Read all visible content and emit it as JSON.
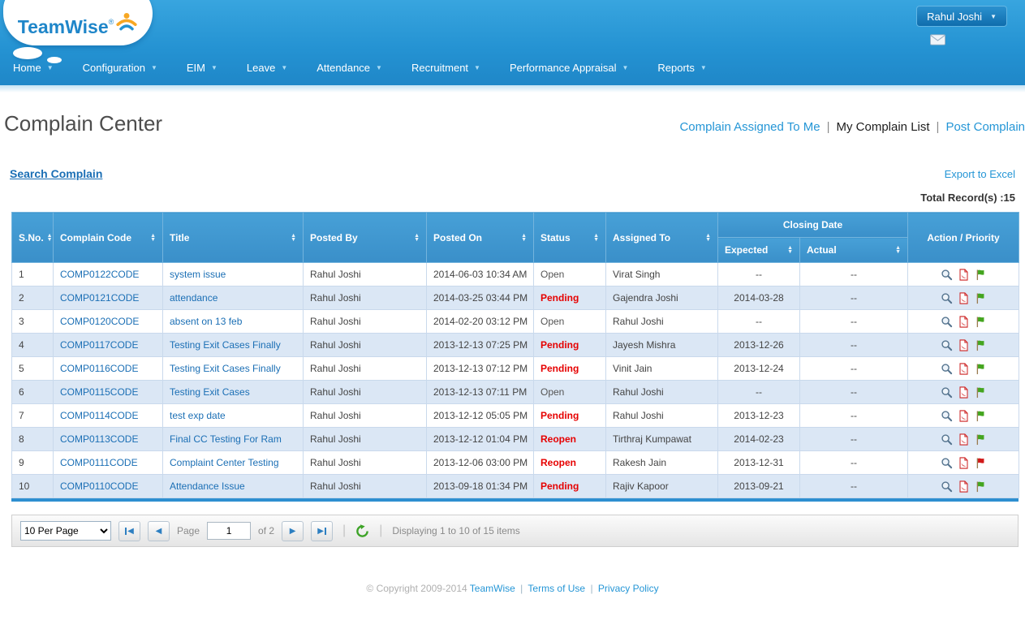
{
  "header": {
    "logo": {
      "text": "TeamWise",
      "registered": "®"
    },
    "user_menu": {
      "name": "Rahul Joshi"
    }
  },
  "nav": {
    "items": [
      "Home",
      "Configuration",
      "EIM",
      "Leave",
      "Attendance",
      "Recruitment",
      "Performance Appraisal",
      "Reports"
    ]
  },
  "page": {
    "title": "Complain Center",
    "separator": "|",
    "view_links": [
      {
        "label": "Complain Assigned To Me",
        "active": false
      },
      {
        "label": "My Complain List",
        "active": true
      },
      {
        "label": "Post Complain",
        "active": false
      }
    ],
    "search_link": "Search Complain",
    "export_link": "Export to Excel",
    "total_records_label": "Total Record(s) :15"
  },
  "table": {
    "headers": {
      "sno": "S.No.",
      "code": "Complain Code",
      "title": "Title",
      "posted_by": "Posted By",
      "posted_on": "Posted On",
      "status": "Status",
      "assigned_to": "Assigned To",
      "closing_date_group": "Closing Date",
      "expected": "Expected",
      "actual": "Actual",
      "action": "Action / Priority"
    },
    "rows": [
      {
        "sno": "1",
        "code": "COMP0122CODE",
        "title": "system issue",
        "posted_by": "Rahul Joshi",
        "posted_on": "2014-06-03 10:34 AM",
        "status": "Open",
        "assigned_to": "Virat Singh",
        "expected": "--",
        "actual": "--",
        "flag": "green"
      },
      {
        "sno": "2",
        "code": "COMP0121CODE",
        "title": "attendance",
        "posted_by": "Rahul Joshi",
        "posted_on": "2014-03-25 03:44 PM",
        "status": "Pending",
        "assigned_to": "Gajendra Joshi",
        "expected": "2014-03-28",
        "actual": "--",
        "flag": "green"
      },
      {
        "sno": "3",
        "code": "COMP0120CODE",
        "title": "absent on 13 feb",
        "posted_by": "Rahul Joshi",
        "posted_on": "2014-02-20 03:12 PM",
        "status": "Open",
        "assigned_to": "Rahul Joshi",
        "expected": "--",
        "actual": "--",
        "flag": "green"
      },
      {
        "sno": "4",
        "code": "COMP0117CODE",
        "title": "Testing Exit Cases Finally",
        "posted_by": "Rahul Joshi",
        "posted_on": "2013-12-13 07:25 PM",
        "status": "Pending",
        "assigned_to": "Jayesh Mishra",
        "expected": "2013-12-26",
        "actual": "--",
        "flag": "green"
      },
      {
        "sno": "5",
        "code": "COMP0116CODE",
        "title": "Testing Exit Cases Finally",
        "posted_by": "Rahul Joshi",
        "posted_on": "2013-12-13 07:12 PM",
        "status": "Pending",
        "assigned_to": "Vinit Jain",
        "expected": "2013-12-24",
        "actual": "--",
        "flag": "green"
      },
      {
        "sno": "6",
        "code": "COMP0115CODE",
        "title": "Testing Exit Cases",
        "posted_by": "Rahul Joshi",
        "posted_on": "2013-12-13 07:11 PM",
        "status": "Open",
        "assigned_to": "Rahul Joshi",
        "expected": "--",
        "actual": "--",
        "flag": "green"
      },
      {
        "sno": "7",
        "code": "COMP0114CODE",
        "title": "test exp date",
        "posted_by": "Rahul Joshi",
        "posted_on": "2013-12-12 05:05 PM",
        "status": "Pending",
        "assigned_to": "Rahul Joshi",
        "expected": "2013-12-23",
        "actual": "--",
        "flag": "green"
      },
      {
        "sno": "8",
        "code": "COMP0113CODE",
        "title": "Final CC Testing For Ram",
        "posted_by": "Rahul Joshi",
        "posted_on": "2013-12-12 01:04 PM",
        "status": "Reopen",
        "assigned_to": "Tirthraj Kumpawat",
        "expected": "2014-02-23",
        "actual": "--",
        "flag": "green"
      },
      {
        "sno": "9",
        "code": "COMP0111CODE",
        "title": "Complaint Center Testing",
        "posted_by": "Rahul Joshi",
        "posted_on": "2013-12-06 03:00 PM",
        "status": "Reopen",
        "assigned_to": "Rakesh Jain",
        "expected": "2013-12-31",
        "actual": "--",
        "flag": "red"
      },
      {
        "sno": "10",
        "code": "COMP0110CODE",
        "title": "Attendance Issue",
        "posted_by": "Rahul Joshi",
        "posted_on": "2013-09-18 01:34 PM",
        "status": "Pending",
        "assigned_to": "Rajiv Kapoor",
        "expected": "2013-09-21",
        "actual": "--",
        "flag": "green"
      }
    ]
  },
  "pagination": {
    "per_page": "10 Per Page",
    "page_label": "Page",
    "page_value": "1",
    "of_label": "of 2",
    "summary": "Displaying 1 to 10 of 15 items"
  },
  "footer": {
    "copyright": "© Copyright 2009-2014",
    "separator": "|",
    "links": [
      "TeamWise",
      "Terms of Use",
      "Privacy Policy"
    ]
  },
  "icons": {
    "view": "view-icon",
    "pdf": "pdf-icon",
    "flag": "priority-flag-icon",
    "refresh": "refresh-icon",
    "mail": "mail-icon",
    "sort": "sort-icon",
    "first": "first-page-icon",
    "previous": "previous-page-icon",
    "next": "next-page-icon",
    "last": "last-page-icon"
  },
  "colors": {
    "header_blue": "#2492d2",
    "table_header_blue": "#3f97d0",
    "row_alt_blue": "#dbe7f5",
    "link_blue": "#1b6fb5",
    "tab_link_blue": "#2596d6",
    "status_red": "#e60000",
    "flag_green": "#44a51f",
    "flag_red": "#d11a1a",
    "table_bottom_bar": "#2e8fd0"
  }
}
